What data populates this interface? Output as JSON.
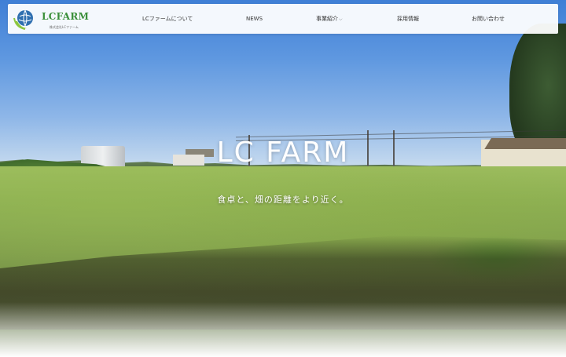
{
  "brand": {
    "name": "LCFARM",
    "tagline": "株式会社LCファーム",
    "colors": {
      "green": "#3a8f3a",
      "blue": "#2f6fb0"
    }
  },
  "nav": {
    "items": [
      {
        "label": "LCファームについて",
        "has_dropdown": false
      },
      {
        "label": "NEWS",
        "has_dropdown": false
      },
      {
        "label": "事業紹介",
        "has_dropdown": true
      },
      {
        "label": "採用情報",
        "has_dropdown": false
      },
      {
        "label": "お問い合わせ",
        "has_dropdown": false
      }
    ],
    "dropdown_icon": "chevron-down-icon"
  },
  "hero": {
    "title": "LC FARM",
    "subtitle": "食卓と、畑の距離をより近く。"
  }
}
